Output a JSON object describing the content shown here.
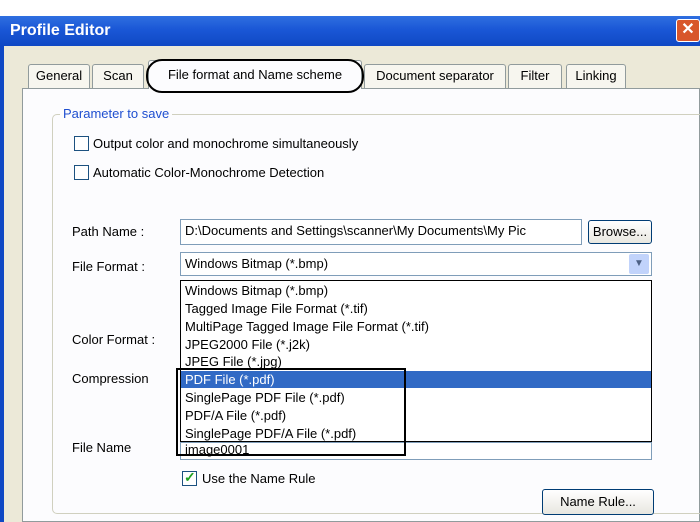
{
  "window": {
    "title": "Profile Editor",
    "close_glyph": "✕"
  },
  "tabs": [
    "General",
    "Scan",
    "File format and Name scheme",
    "Document separator",
    "Filter",
    "Linking"
  ],
  "group": {
    "legend": "Parameter to save"
  },
  "options": {
    "output_both": {
      "label": "Output color and monochrome simultaneously",
      "checked": false
    },
    "auto_detect": {
      "label": "Automatic Color-Monochrome Detection",
      "checked": false
    }
  },
  "path": {
    "label": "Path Name :",
    "value": "D:\\Documents and Settings\\scanner\\My Documents\\My Pic",
    "browse_label": "Browse..."
  },
  "file_format": {
    "label": "File Format :",
    "selected": "Windows Bitmap (*.bmp)",
    "options": [
      "Windows Bitmap (*.bmp)",
      "Tagged Image File Format (*.tif)",
      "MultiPage Tagged Image File Format (*.tif)",
      "JPEG2000 File (*.j2k)",
      "JPEG File (*.jpg)",
      "PDF File (*.pdf)",
      "SinglePage PDF File (*.pdf)",
      "PDF/A File (*.pdf)",
      "SinglePage PDF/A File (*.pdf)"
    ],
    "highlighted_index": 5
  },
  "color_format": {
    "label": "Color Format :"
  },
  "compression": {
    "label": "Compression"
  },
  "file_name": {
    "label": "File Name",
    "value": "image0001"
  },
  "name_rule": {
    "label": "Use the Name Rule",
    "checked": true,
    "button_label": "Name Rule..."
  },
  "colors": {
    "titlebar": "#0f48c4",
    "selection": "#316ac5",
    "legend": "#1f4fd0"
  }
}
